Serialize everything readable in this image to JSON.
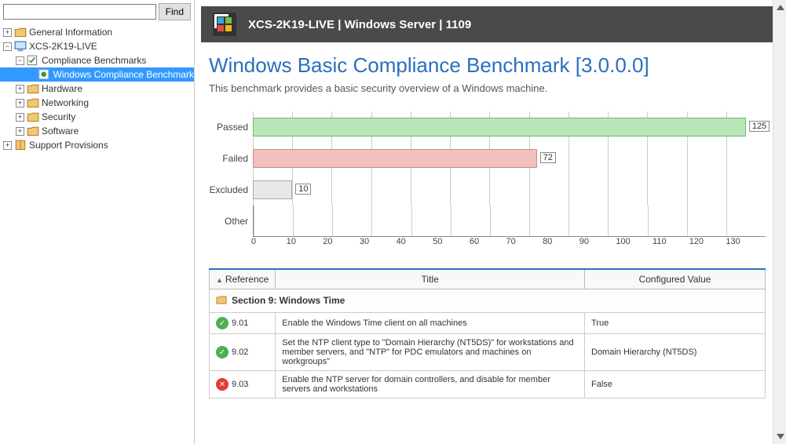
{
  "search": {
    "placeholder": "",
    "find_label": "Find"
  },
  "tree": {
    "n0": "General Information",
    "n1": "XCS-2K19-LIVE",
    "n2": "Compliance Benchmarks",
    "n3": "Windows Compliance Benchmark",
    "n4": "Hardware",
    "n5": "Networking",
    "n6": "Security",
    "n7": "Software",
    "n8": "Support Provisions"
  },
  "titlebar": "XCS-2K19-LIVE | Windows Server | 1109",
  "page": {
    "title": "Windows Basic Compliance Benchmark [3.0.0.0]",
    "desc": "This benchmark provides a basic security overview of a Windows machine."
  },
  "chart_data": {
    "type": "bar",
    "orientation": "horizontal",
    "categories": [
      "Passed",
      "Failed",
      "Excluded",
      "Other"
    ],
    "values": [
      125,
      72,
      10,
      0
    ],
    "xlabel": "",
    "ylabel": "",
    "xlim": [
      0,
      130
    ],
    "ticks": [
      0,
      10,
      20,
      30,
      40,
      50,
      60,
      70,
      80,
      90,
      100,
      110,
      120,
      130
    ]
  },
  "table": {
    "headers": {
      "ref": "Reference",
      "title": "Title",
      "val": "Configured Value"
    },
    "section": "Section 9: Windows Time",
    "rows": [
      {
        "status": "ok",
        "ref": "9.01",
        "title": "Enable the Windows Time client on all machines",
        "val": "True"
      },
      {
        "status": "ok",
        "ref": "9.02",
        "title": "Set the NTP client type to \"Domain Hierarchy (NT5DS)\" for workstations and member servers, and \"NTP\" for PDC emulators and machines on workgroups\"",
        "val": "Domain Hierarchy (NT5DS)"
      },
      {
        "status": "bad",
        "ref": "9.03",
        "title": "Enable the NTP server for domain controllers, and disable for member servers and workstations",
        "val": "False"
      }
    ]
  }
}
